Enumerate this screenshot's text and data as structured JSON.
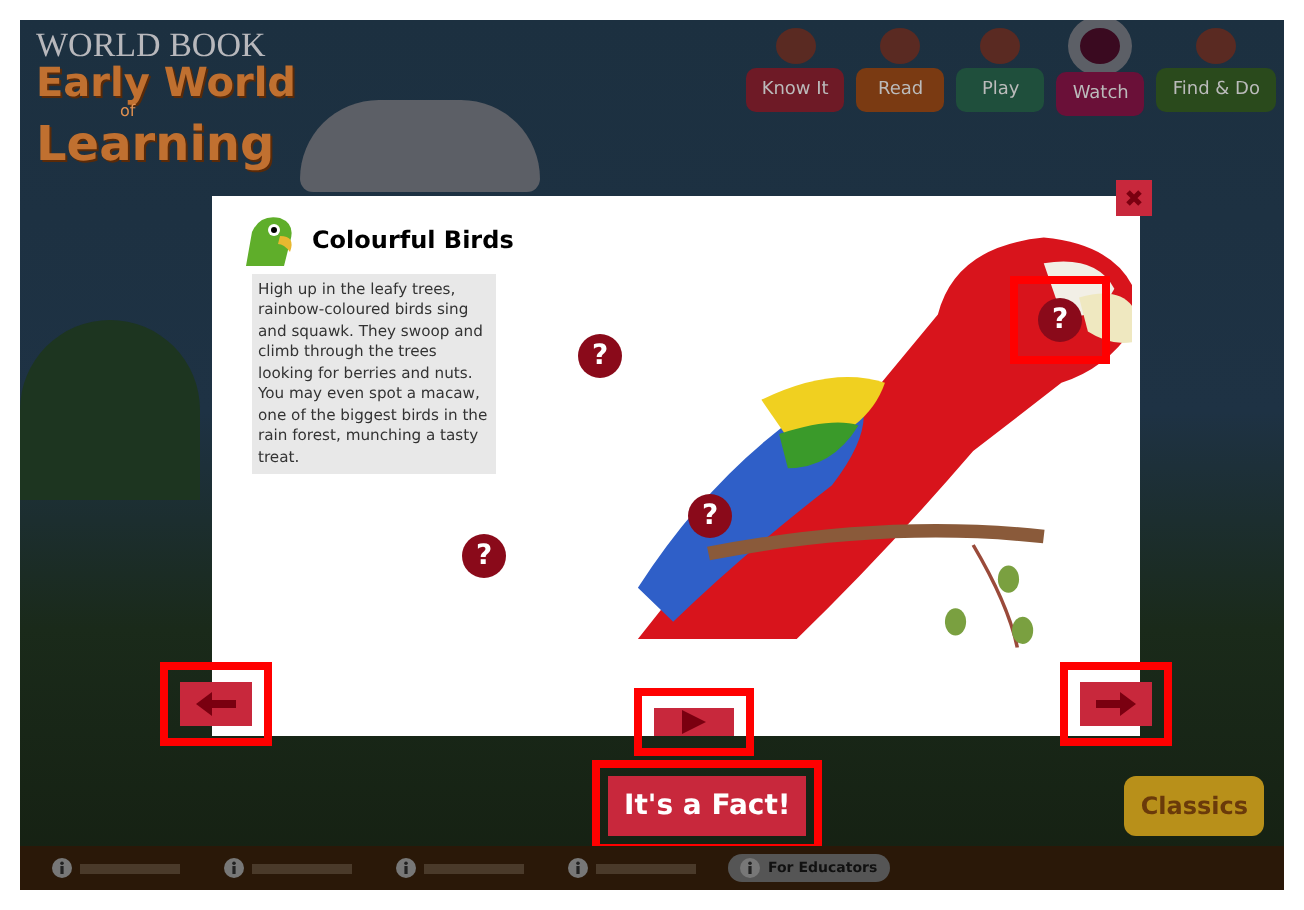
{
  "header": {
    "brand": "WORLD BOOK",
    "title_top": "Early World",
    "title_small": "of",
    "title_bottom": "Learning"
  },
  "nav": [
    {
      "label": "Know It",
      "color": "#6e1a26",
      "selected": false
    },
    {
      "label": "Read",
      "color": "#7a3a12",
      "selected": false
    },
    {
      "label": "Play",
      "color": "#1f4f3c",
      "selected": false
    },
    {
      "label": "Watch",
      "color": "#6a1038",
      "selected": true
    },
    {
      "label": "Find & Do",
      "color": "#2a4a1c",
      "selected": false
    }
  ],
  "modal": {
    "title": "Colourful Birds",
    "text": "High up in the leafy trees, rainbow-coloured birds sing and squawk. They swoop and climb through the trees looking for berries and nuts. You may even spot a macaw, one of the biggest birds in the rain forest, munching a tasty treat.",
    "hotspots": [
      {
        "label": "?",
        "highlighted": false
      },
      {
        "label": "?",
        "highlighted": false
      },
      {
        "label": "?",
        "highlighted": false
      },
      {
        "label": "?",
        "highlighted": true
      }
    ]
  },
  "controls": {
    "prev_highlighted": true,
    "play_highlighted": true,
    "next_highlighted": true,
    "fact_button": "It's a Fact!",
    "fact_highlighted": true
  },
  "side_button": "Classics",
  "footer": [
    {
      "selected": false
    },
    {
      "selected": false
    },
    {
      "selected": false
    },
    {
      "selected": false
    },
    {
      "label": "For Educators",
      "selected": true
    }
  ]
}
